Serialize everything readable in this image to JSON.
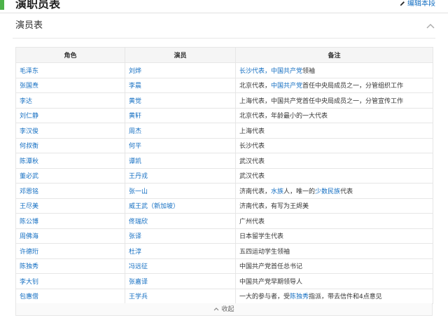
{
  "section": {
    "title": "演职员表",
    "edit_label": "编辑本段"
  },
  "subsection": {
    "title": "演员表"
  },
  "table": {
    "headers": [
      "角色",
      "演员",
      "备注"
    ],
    "rows": [
      {
        "role": "毛泽东",
        "actor": "刘烨",
        "note": [
          {
            "t": "长沙代表，",
            "l": true
          },
          {
            "t": "中国共产党",
            "l": true
          },
          {
            "t": "领袖",
            "l": false
          }
        ]
      },
      {
        "role": "张国焘",
        "actor": "李晨",
        "note": [
          {
            "t": "北京代表，",
            "l": false
          },
          {
            "t": "中国共产党",
            "l": true
          },
          {
            "t": "首任中央局成员之一，分管组织工作",
            "l": false
          }
        ]
      },
      {
        "role": "李达",
        "actor": "黄觉",
        "note": [
          {
            "t": "上海代表，中国共产党首任中央局成员之一，分管宣传工作",
            "l": false
          }
        ]
      },
      {
        "role": "刘仁静",
        "actor": "黄轩",
        "note": [
          {
            "t": "北京代表，年龄最小的一大代表",
            "l": false
          }
        ]
      },
      {
        "role": "李汉俊",
        "actor": "周杰",
        "note": [
          {
            "t": "上海代表",
            "l": false
          }
        ]
      },
      {
        "role": "何叔衡",
        "actor": "何平",
        "note": [
          {
            "t": "长沙代表",
            "l": false
          }
        ]
      },
      {
        "role": "陈潭秋",
        "actor": "谭凯",
        "note": [
          {
            "t": "武汉代表",
            "l": false
          }
        ]
      },
      {
        "role": "董必武",
        "actor": "王丹戎",
        "note": [
          {
            "t": "武汉代表",
            "l": false
          }
        ]
      },
      {
        "role": "邓恩铭",
        "actor": "张一山",
        "note": [
          {
            "t": "济南代表，",
            "l": false
          },
          {
            "t": "水族",
            "l": true
          },
          {
            "t": "人，唯一的",
            "l": false
          },
          {
            "t": "少数民族",
            "l": true
          },
          {
            "t": "代表",
            "l": false
          }
        ]
      },
      {
        "role": "王尽美",
        "actor": "威王武（新加坡）",
        "note": [
          {
            "t": "济南代表，有写为王烬美",
            "l": false
          }
        ]
      },
      {
        "role": "陈公博",
        "actor": "佟瑞欣",
        "note": [
          {
            "t": "广州代表",
            "l": false
          }
        ]
      },
      {
        "role": "周佛海",
        "actor": "张译",
        "note": [
          {
            "t": "日本留学生代表",
            "l": false
          }
        ]
      },
      {
        "role": "许德珩",
        "actor": "杜淳",
        "note": [
          {
            "t": "五四运动学生领袖",
            "l": false
          }
        ]
      },
      {
        "role": "陈独秀",
        "actor": "冯远征",
        "note": [
          {
            "t": "中国共产党首任总书记",
            "l": false
          }
        ]
      },
      {
        "role": "李大钊",
        "actor": "张嘉译",
        "note": [
          {
            "t": "中国共产党早期领导人",
            "l": false
          }
        ]
      },
      {
        "role": "包惠僧",
        "actor": "王学兵",
        "note": [
          {
            "t": "一大的参与者，受",
            "l": false
          },
          {
            "t": "陈独秀",
            "l": true
          },
          {
            "t": "指派，带去信件和4点意见",
            "l": false
          }
        ]
      }
    ]
  },
  "collapse_label": "收起",
  "colors": {
    "accent": "#4db24a",
    "link": "#136ec2"
  },
  "icons": [
    "pencil-icon",
    "chevron-up-icon"
  ]
}
